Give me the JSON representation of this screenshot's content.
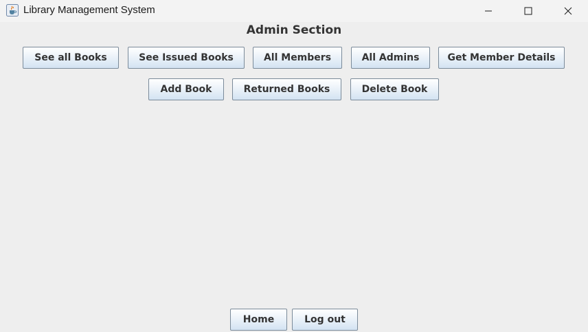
{
  "window": {
    "title": "Library Management System",
    "icon": "java-cup-icon",
    "controls": [
      "minimize-icon",
      "maximize-icon",
      "close-icon"
    ]
  },
  "heading": "Admin Section",
  "buttons_row1": [
    {
      "label": "See all Books"
    },
    {
      "label": "See Issued Books"
    },
    {
      "label": "All Members"
    },
    {
      "label": "All Admins"
    },
    {
      "label": "Get Member Details"
    }
  ],
  "buttons_row2": [
    {
      "label": "Add Book"
    },
    {
      "label": "Returned Books"
    },
    {
      "label": "Delete Book"
    }
  ],
  "footer_buttons": [
    {
      "label": "Home"
    },
    {
      "label": "Log out"
    }
  ],
  "colors": {
    "background": "#eeeeee",
    "titlebar": "#f3f3f3",
    "button_border": "#7a8a99",
    "text": "#333333"
  }
}
